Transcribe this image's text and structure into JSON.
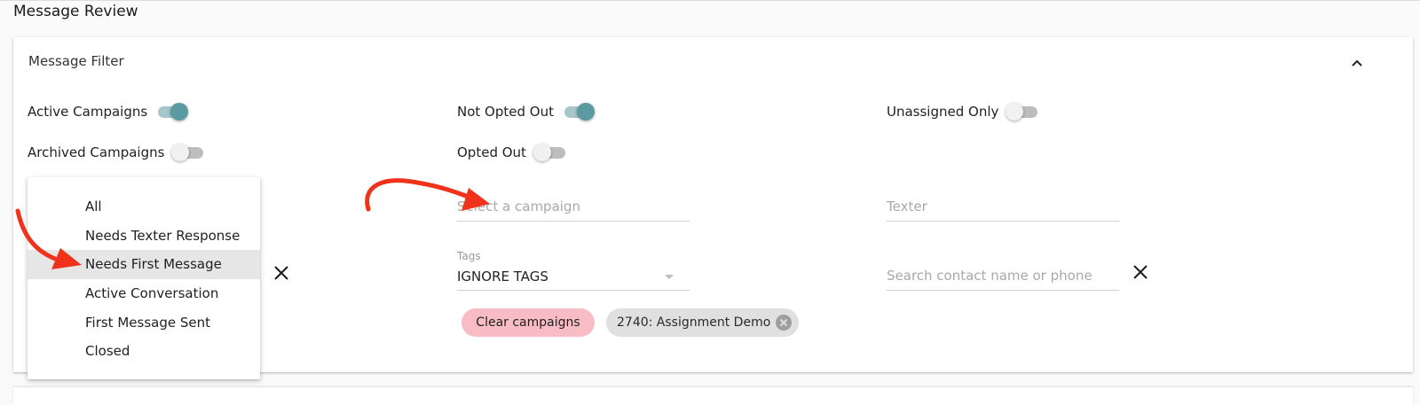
{
  "page": {
    "title": "Message Review"
  },
  "filter": {
    "title": "Message Filter",
    "toggles": {
      "active_campaigns": {
        "label": "Active Campaigns",
        "on": true
      },
      "archived_campaigns": {
        "label": "Archived Campaigns",
        "on": false
      },
      "not_opted_out": {
        "label": "Not Opted Out",
        "on": true
      },
      "opted_out": {
        "label": "Opted Out",
        "on": false
      },
      "unassigned_only": {
        "label": "Unassigned Only",
        "on": false
      }
    },
    "campaign_input": {
      "placeholder": "Select a campaign",
      "value": ""
    },
    "texter_input": {
      "placeholder": "Texter",
      "value": ""
    },
    "tags_select": {
      "label": "Tags",
      "value": "IGNORE TAGS"
    },
    "contact_search": {
      "placeholder": "Search contact name or phone",
      "value": ""
    },
    "chips": {
      "clear": "Clear campaigns",
      "campaign": "2740: Assignment Demo"
    },
    "message_status_menu": {
      "items": [
        {
          "label": "All"
        },
        {
          "label": "Needs Texter Response"
        },
        {
          "label": "Needs First Message"
        },
        {
          "label": "Active Conversation"
        },
        {
          "label": "First Message Sent"
        },
        {
          "label": "Closed"
        }
      ],
      "selected_index": 2
    }
  },
  "icons": {
    "collapse": "chevron-up-icon",
    "clear_status": "close-icon",
    "clear_search": "close-icon",
    "chip_delete": "cancel-circle-icon"
  },
  "colors": {
    "toggle_on_thumb": "#5b9aa0",
    "toggle_on_track": "#a7c6c9",
    "toggle_off_track": "#bdbdbd",
    "clear_chip": "#f8bcc4",
    "annotation_arrow": "#f0321a"
  }
}
